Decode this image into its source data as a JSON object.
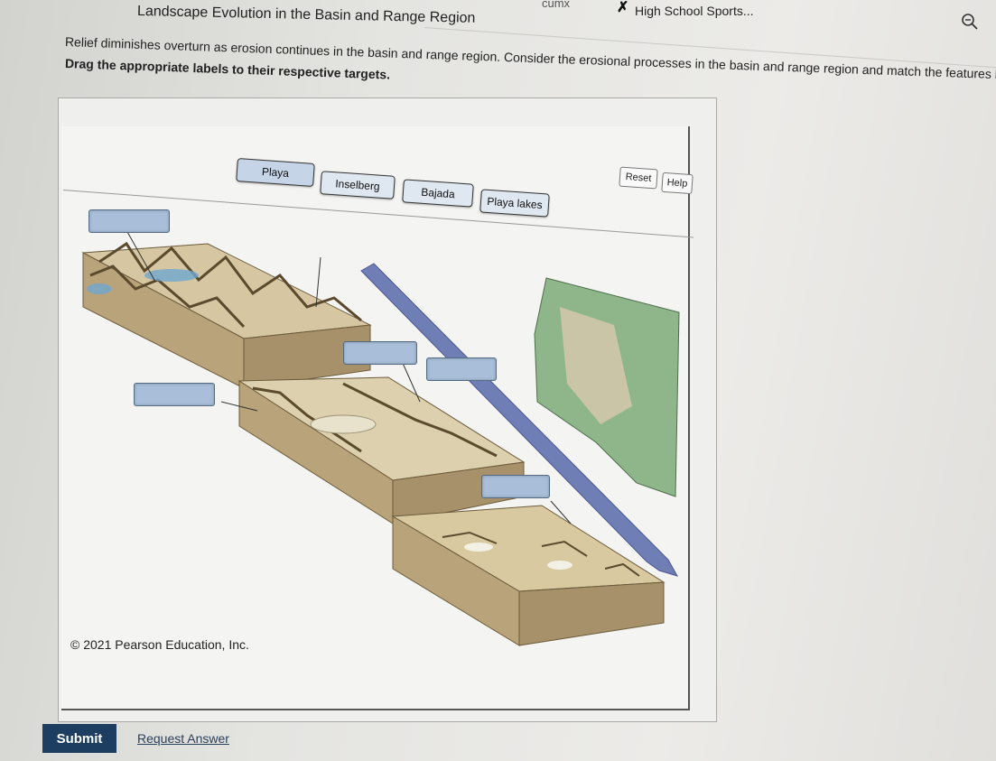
{
  "browser": {
    "crumb": "cumx",
    "tab_label": "High School Sports...",
    "close_icon": "x-icon",
    "zoom_icon": "magnifier-icon"
  },
  "header": {
    "title": "Landscape Evolution in the Basin and Range Region"
  },
  "instructions": {
    "intro": "Relief diminishes overturn as erosion continues in the basin and range region. Consider the erosional processes in the basin and range region and match the features below. One feature will be u",
    "drag_prompt": "Drag the appropriate labels to their respective targets."
  },
  "toolbar": {
    "reset_label": "Reset",
    "help_label": "Help"
  },
  "labels": [
    "Playa",
    "Inselberg",
    "Bajada",
    "Playa lakes"
  ],
  "figure": {
    "copyright": "© 2021 Pearson Education, Inc.",
    "colors": {
      "target": "#a9bfd9",
      "arrow": "#6f7fb6",
      "terrain": "#c9b890",
      "water": "#6fa6cf"
    }
  },
  "actions": {
    "submit_label": "Submit",
    "request_answer_label": "Request Answer"
  }
}
